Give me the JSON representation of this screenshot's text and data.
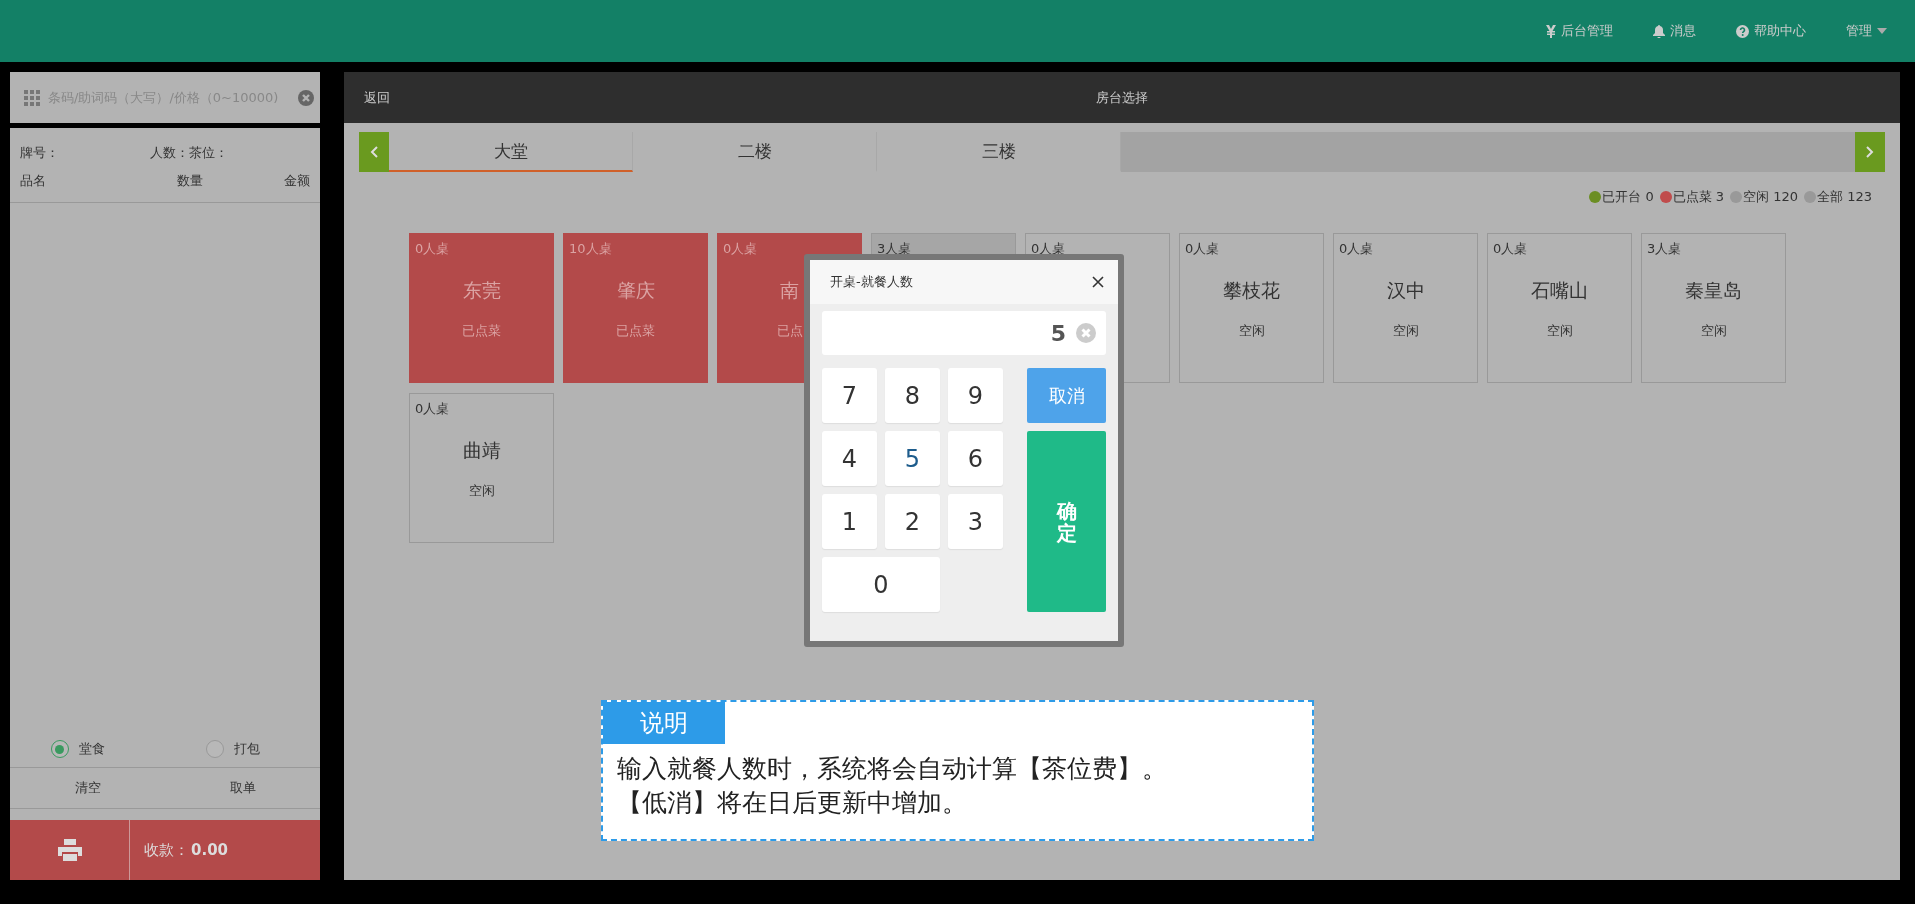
{
  "top_bar": {
    "items": [
      {
        "kind": "yen",
        "label": "后台管理",
        "dropdown": false
      },
      {
        "kind": "bell",
        "label": "消息",
        "dropdown": false
      },
      {
        "kind": "help",
        "label": "帮助中心",
        "dropdown": false
      },
      {
        "kind": "none",
        "label": "管理",
        "dropdown": true
      }
    ]
  },
  "sidebar": {
    "search": {
      "placeholder": "条码/助词码（大写）/价格（0~10000)"
    },
    "order_labels": [
      "牌号：",
      "人数：",
      "茶位："
    ],
    "columns": [
      "品名",
      "数量",
      "金额"
    ],
    "dining_options": [
      {
        "label": "堂食",
        "selected": true
      },
      {
        "label": "打包",
        "selected": false
      }
    ],
    "actions": [
      "清空",
      "取单"
    ],
    "checkout": {
      "label": "收款：",
      "amount": "0.00"
    }
  },
  "room_panel": {
    "back": "返回",
    "title": "房台选择",
    "tabs": [
      {
        "label": "大堂",
        "selected": true
      },
      {
        "label": "二楼",
        "selected": false
      },
      {
        "label": "三楼",
        "selected": false
      }
    ],
    "legend": [
      {
        "label": "已开台 0",
        "color": "#6b8e23"
      },
      {
        "label": "已点菜 3",
        "color": "#c04c4c"
      },
      {
        "label": "空闲 120",
        "color": "#999999"
      },
      {
        "label": "全部 123",
        "color": "#999999"
      }
    ],
    "tables": [
      {
        "seats": "0人桌",
        "name": "东莞",
        "status": "已点菜",
        "kind": "ordered",
        "selected": false
      },
      {
        "seats": "10人桌",
        "name": "肇庆",
        "status": "已点菜",
        "kind": "ordered",
        "selected": false
      },
      {
        "seats": "0人桌",
        "name": "南",
        "status": "已点",
        "kind": "ordered",
        "selected": false
      },
      {
        "seats": "3人桌",
        "kind": "idle",
        "selected": true
      },
      {
        "seats": "0人桌",
        "kind": "idle",
        "selected": false
      },
      {
        "seats": "0人桌",
        "name": "攀枝花",
        "status": "空闲",
        "kind": "idle",
        "selected": false
      },
      {
        "seats": "0人桌",
        "name": "汉中",
        "status": "空闲",
        "kind": "idle",
        "selected": false
      },
      {
        "seats": "0人桌",
        "name": "石嘴山",
        "status": "空闲",
        "kind": "idle",
        "selected": false
      },
      {
        "seats": "3人桌",
        "name": "秦皇岛",
        "status": "空闲",
        "kind": "idle",
        "selected": false
      },
      {
        "seats": "0人桌",
        "name": "曲靖",
        "status": "空闲",
        "kind": "idle",
        "selected": false
      }
    ]
  },
  "dialog": {
    "title": "开桌-就餐人数",
    "value": "5",
    "keys": [
      {
        "label": "7",
        "selected": false
      },
      {
        "label": "8",
        "selected": false
      },
      {
        "label": "9",
        "selected": false
      },
      {
        "label": "4",
        "selected": false
      },
      {
        "label": "5",
        "selected": true
      },
      {
        "label": "6",
        "selected": false
      },
      {
        "label": "1",
        "selected": false
      },
      {
        "label": "2",
        "selected": false
      },
      {
        "label": "3",
        "selected": false
      },
      {
        "label": "0",
        "selected": false
      }
    ],
    "cancel": "取消",
    "confirm": "确定"
  },
  "note": {
    "title": "说明",
    "lines": [
      "输入就餐人数时，系统将会自动计算【茶位费】。",
      "【低消】将在日后更新中增加。"
    ]
  }
}
